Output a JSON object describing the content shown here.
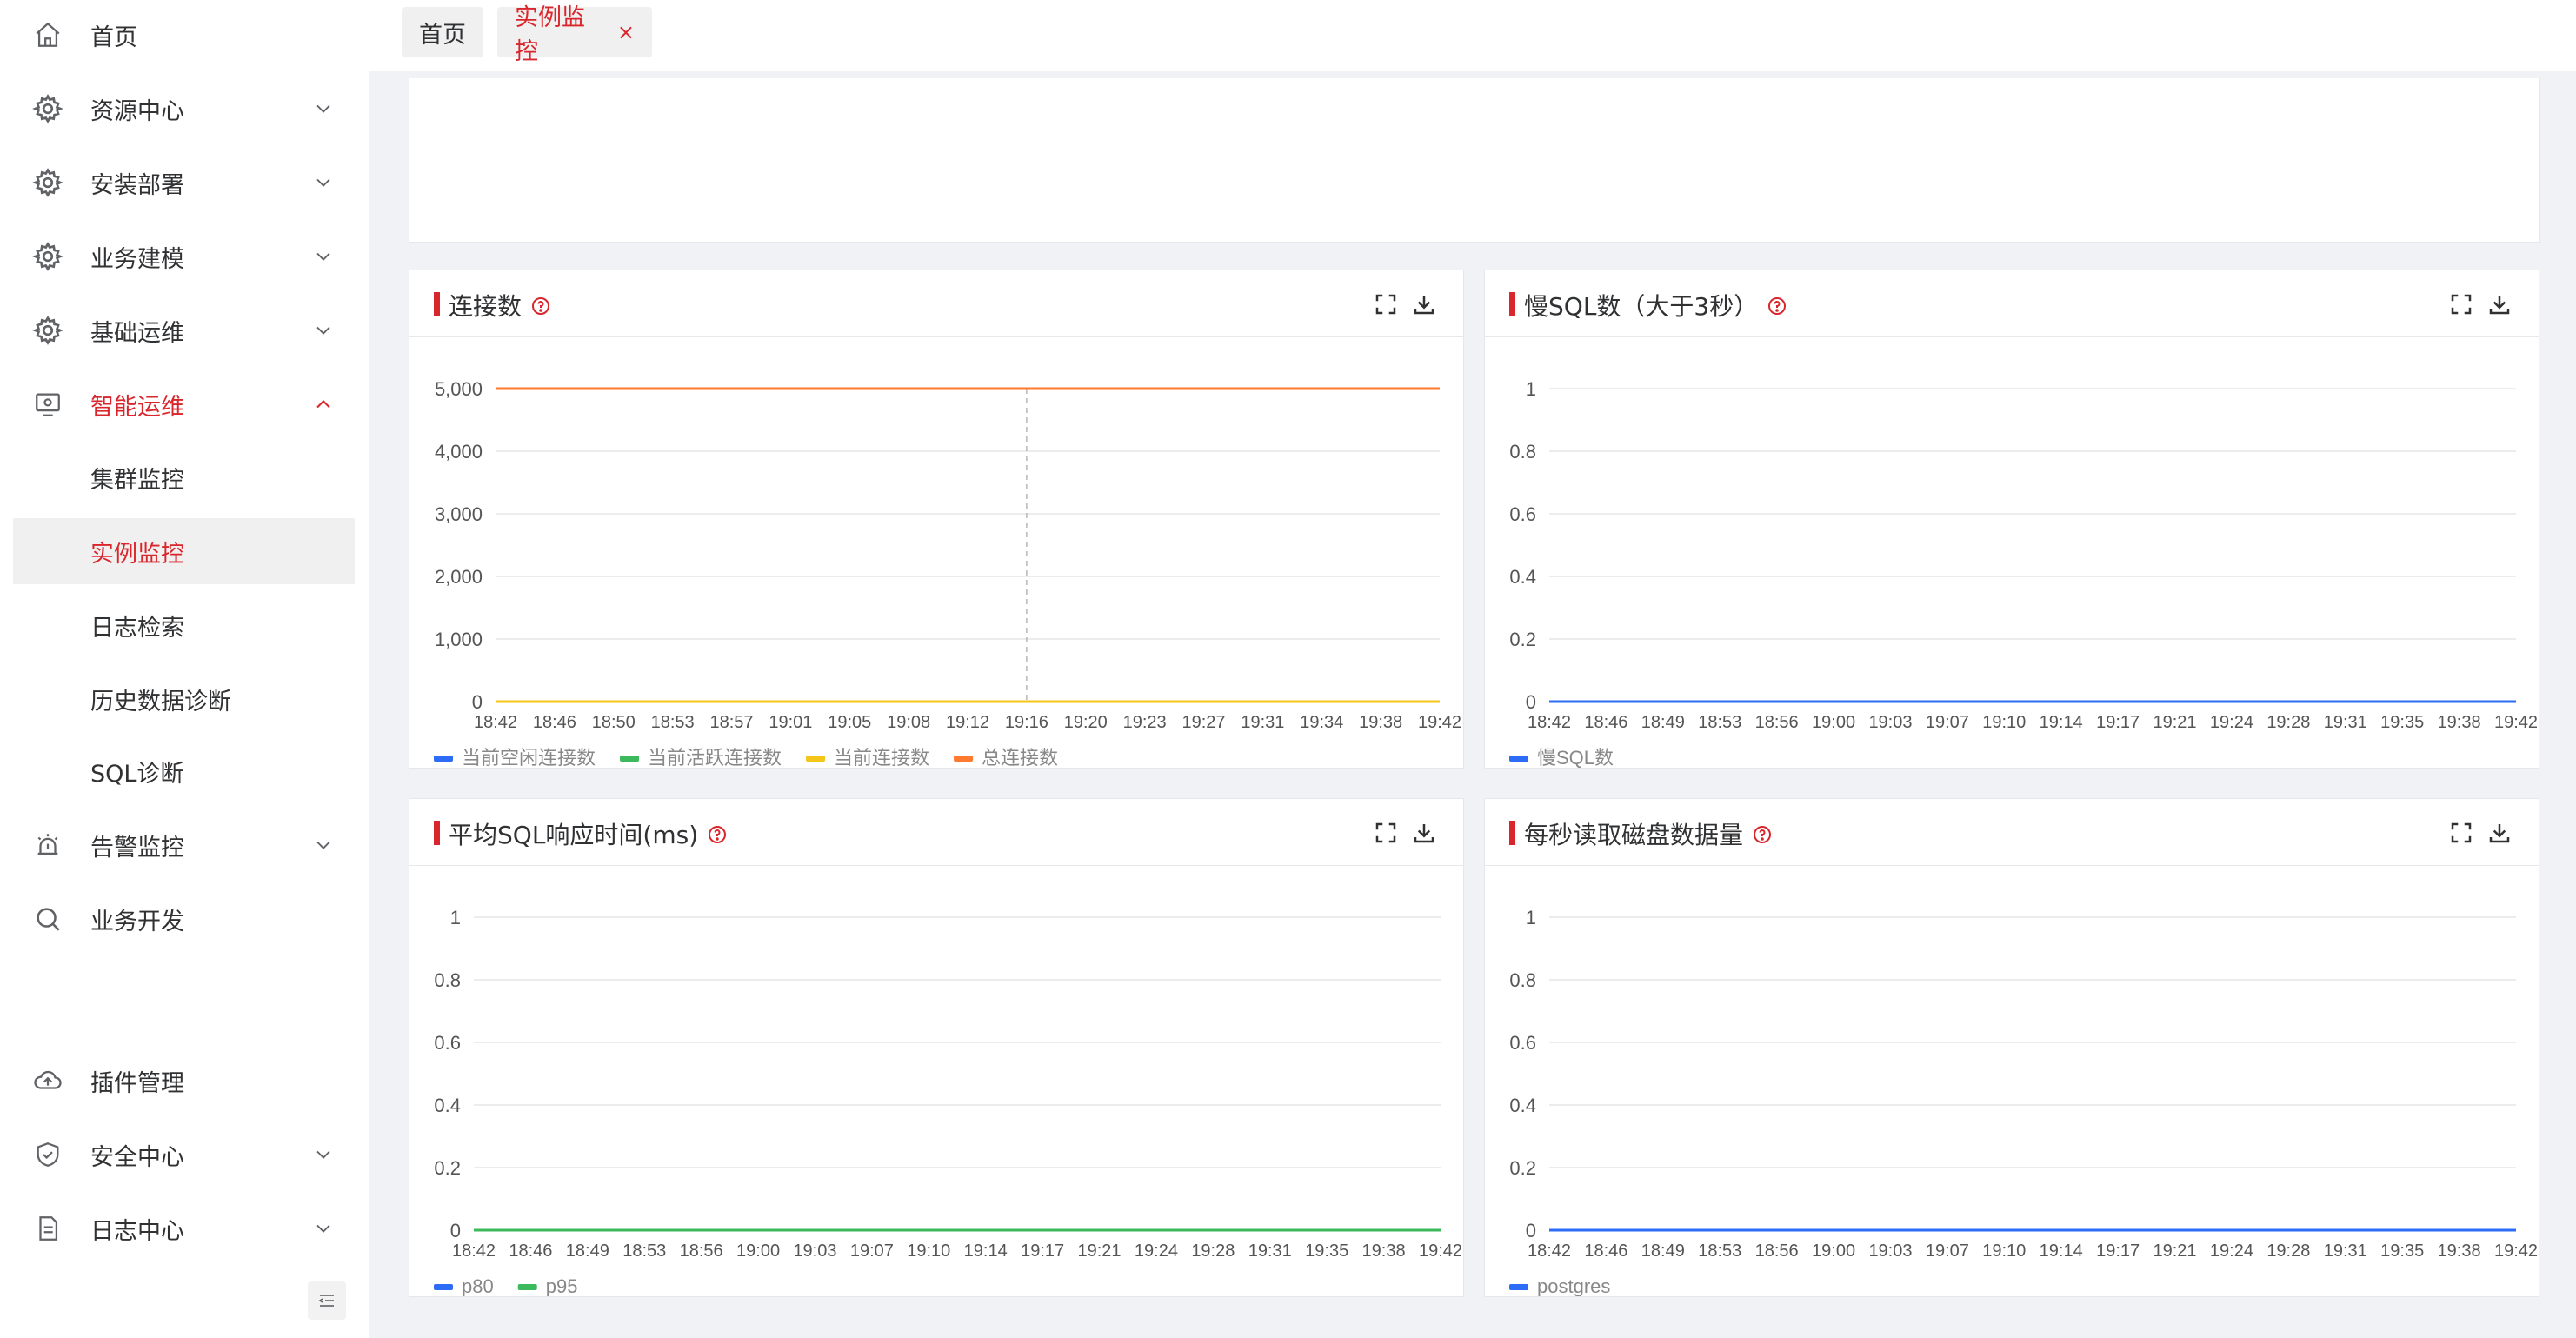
{
  "sidebar": {
    "items": [
      {
        "label": "首页",
        "icon": "home-icon"
      },
      {
        "label": "资源中心",
        "icon": "gear-icon"
      },
      {
        "label": "安装部署",
        "icon": "gear-icon"
      },
      {
        "label": "业务建模",
        "icon": "gear-icon"
      },
      {
        "label": "基础运维",
        "icon": "gear-icon"
      },
      {
        "label": "智能运维",
        "icon": "monitor-icon"
      },
      {
        "label": "告警监控",
        "icon": "alarm-icon"
      },
      {
        "label": "业务开发",
        "icon": "search-icon"
      },
      {
        "label": "插件管理",
        "icon": "cloud-plugin-icon"
      },
      {
        "label": "安全中心",
        "icon": "shield-icon"
      },
      {
        "label": "日志中心",
        "icon": "document-icon"
      }
    ],
    "sub_items": [
      {
        "label": "集群监控"
      },
      {
        "label": "实例监控"
      },
      {
        "label": "日志检索"
      },
      {
        "label": "历史数据诊断"
      },
      {
        "label": "SQL诊断"
      }
    ],
    "active_group": "智能运维",
    "selected_item": "实例监控"
  },
  "tabs": [
    {
      "label": "首页"
    },
    {
      "label": "实例监控",
      "close": "×"
    }
  ],
  "colors": {
    "accent": "#d9262c",
    "blue": "#2c6cf6",
    "green": "#3cb95c",
    "yellow": "#f5c518",
    "orange": "#ff7a2e"
  },
  "chart_data": [
    {
      "type": "line",
      "title": "连接数",
      "x": [
        "18:42",
        "18:46",
        "18:50",
        "18:53",
        "18:57",
        "19:01",
        "19:05",
        "19:08",
        "19:12",
        "19:16",
        "19:20",
        "19:23",
        "19:27",
        "19:31",
        "19:34",
        "19:38",
        "19:42"
      ],
      "ytick_labels": [
        "5,000",
        "4,000",
        "3,000",
        "2,000",
        "1,000",
        "0"
      ],
      "ylim": [
        0,
        5000
      ],
      "series": [
        {
          "name": "当前空闲连接数",
          "color": "#2c6cf6",
          "values": [
            0,
            0,
            0,
            0,
            0,
            0,
            0,
            0,
            0,
            0,
            0,
            0,
            0,
            0,
            0,
            0,
            0
          ]
        },
        {
          "name": "当前活跃连接数",
          "color": "#3cb95c",
          "values": [
            0,
            0,
            0,
            0,
            0,
            0,
            0,
            0,
            0,
            0,
            0,
            0,
            0,
            0,
            0,
            0,
            0
          ]
        },
        {
          "name": "当前连接数",
          "color": "#f5c518",
          "values": [
            0,
            0,
            0,
            0,
            0,
            0,
            0,
            0,
            0,
            0,
            0,
            0,
            0,
            0,
            0,
            0,
            0
          ]
        },
        {
          "name": "总连接数",
          "color": "#ff7a2e",
          "values": [
            5000,
            5000,
            5000,
            5000,
            5000,
            5000,
            5000,
            5000,
            5000,
            5000,
            5000,
            5000,
            5000,
            5000,
            5000,
            5000,
            5000
          ]
        }
      ],
      "hover_x": "19:16",
      "legend": "bottom-left",
      "grid": true
    },
    {
      "type": "line",
      "title": "慢SQL数（大于3秒）",
      "x": [
        "18:42",
        "18:46",
        "18:49",
        "18:53",
        "18:56",
        "19:00",
        "19:03",
        "19:07",
        "19:10",
        "19:14",
        "19:17",
        "19:21",
        "19:24",
        "19:28",
        "19:31",
        "19:35",
        "19:38",
        "19:42"
      ],
      "ytick_labels": [
        "1",
        "0.8",
        "0.6",
        "0.4",
        "0.2",
        "0"
      ],
      "ylim": [
        0,
        1
      ],
      "series": [
        {
          "name": "慢SQL数",
          "color": "#2c6cf6",
          "values": [
            0,
            0,
            0,
            0,
            0,
            0,
            0,
            0,
            0,
            0,
            0,
            0,
            0,
            0,
            0,
            0,
            0,
            0
          ]
        }
      ],
      "legend": "bottom-left",
      "grid": true
    },
    {
      "type": "line",
      "title": "平均SQL响应时间(ms)",
      "x": [
        "18:42",
        "18:46",
        "18:49",
        "18:53",
        "18:56",
        "19:00",
        "19:03",
        "19:07",
        "19:10",
        "19:14",
        "19:17",
        "19:21",
        "19:24",
        "19:28",
        "19:31",
        "19:35",
        "19:38",
        "19:42"
      ],
      "ytick_labels": [
        "1",
        "0.8",
        "0.6",
        "0.4",
        "0.2",
        "0"
      ],
      "ylim": [
        0,
        1
      ],
      "series": [
        {
          "name": "p80",
          "color": "#2c6cf6",
          "values": [
            0,
            0,
            0,
            0,
            0,
            0,
            0,
            0,
            0,
            0,
            0,
            0,
            0,
            0,
            0,
            0,
            0,
            0
          ]
        },
        {
          "name": "p95",
          "color": "#3cb95c",
          "values": [
            0,
            0,
            0,
            0,
            0,
            0,
            0,
            0,
            0,
            0,
            0,
            0,
            0,
            0,
            0,
            0,
            0,
            0
          ]
        }
      ],
      "legend": "bottom-left",
      "grid": true
    },
    {
      "type": "line",
      "title": "每秒读取磁盘数据量",
      "x": [
        "18:42",
        "18:46",
        "18:49",
        "18:53",
        "18:56",
        "19:00",
        "19:03",
        "19:07",
        "19:10",
        "19:14",
        "19:17",
        "19:21",
        "19:24",
        "19:28",
        "19:31",
        "19:35",
        "19:38",
        "19:42"
      ],
      "ytick_labels": [
        "1",
        "0.8",
        "0.6",
        "0.4",
        "0.2",
        "0"
      ],
      "ylim": [
        0,
        1
      ],
      "series": [
        {
          "name": "postgres",
          "color": "#2c6cf6",
          "values": [
            0,
            0,
            0,
            0,
            0,
            0,
            0,
            0,
            0,
            0,
            0,
            0,
            0,
            0,
            0,
            0,
            0,
            0
          ]
        }
      ],
      "legend": "bottom-left",
      "grid": true
    }
  ]
}
